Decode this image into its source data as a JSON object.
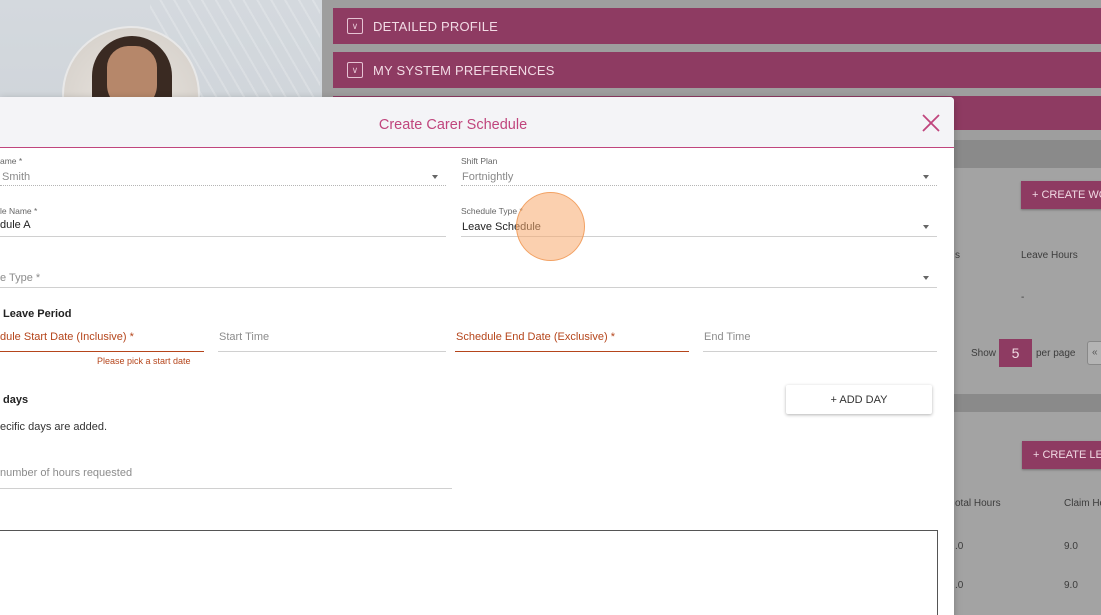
{
  "background": {
    "accordions": [
      {
        "label": "DETAILED PROFILE"
      },
      {
        "label": "MY SYSTEM PREFERENCES"
      }
    ],
    "work_section": {
      "create_button": "+ CREATE WO",
      "leave_hours_header": "Leave Hours",
      "col_fragment": "s",
      "row_value": "-",
      "show_label": "Show",
      "per_page_value": "5",
      "per_page_label": "per page",
      "pager_glyph": "«"
    },
    "leave_section": {
      "create_button": "+ CREATE LEA",
      "total_hours_header": "otal Hours",
      "claim_hours_header": "Claim Ho",
      "rows": [
        {
          "total": ".0",
          "claim": "9.0"
        },
        {
          "total": ".0",
          "claim": "9.0"
        }
      ]
    }
  },
  "modal": {
    "title": "Create Carer Schedule",
    "fields": {
      "carer_name": {
        "label": "ame *",
        "value": "Smith"
      },
      "shift_plan": {
        "label": "Shift Plan",
        "value": "Fortnightly"
      },
      "schedule_name": {
        "label": "le Name *",
        "value": "dule A"
      },
      "schedule_type": {
        "label": "Schedule Type *",
        "value": "Leave Schedule"
      },
      "leave_type": {
        "placeholder": "e Type *"
      }
    },
    "leave_period": {
      "title": "Leave Period",
      "start_date_label": "dule Start Date (Inclusive) *",
      "start_date_error": "Please pick a start date",
      "start_time_placeholder": "Start Time",
      "end_date_label": "Schedule End Date (Exclusive) *",
      "end_time_placeholder": "End Time"
    },
    "days": {
      "title": "days",
      "add_button": "+ ADD DAY",
      "note": "ecific days are added."
    },
    "hours_requested_placeholder": "number of hours requested"
  }
}
